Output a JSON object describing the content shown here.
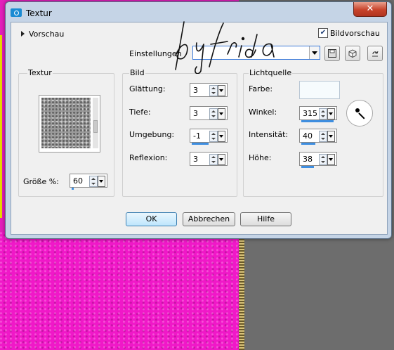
{
  "window": {
    "title": "Textur",
    "close_label": "✕"
  },
  "preview": {
    "toggle_label": "Vorschau",
    "checkbox_label": "Bildvorschau",
    "checked": true
  },
  "settings": {
    "label": "Einstellungen",
    "value": ""
  },
  "watermark": {
    "text": "by frida"
  },
  "texture_group": {
    "title": "Textur",
    "size_label": "Größe %:",
    "size_value": "60"
  },
  "image_group": {
    "title": "Bild",
    "fields": [
      {
        "label": "Glättung:",
        "value": "3"
      },
      {
        "label": "Tiefe:",
        "value": "3"
      },
      {
        "label": "Umgebung:",
        "value": "-1"
      },
      {
        "label": "Reflexion:",
        "value": "3"
      }
    ]
  },
  "light_group": {
    "title": "Lichtquelle",
    "color_label": "Farbe:",
    "color_value": "#f6fbfd",
    "fields": [
      {
        "label": "Winkel:",
        "value": "315"
      },
      {
        "label": "Intensität:",
        "value": "40"
      },
      {
        "label": "Höhe:",
        "value": "38"
      }
    ]
  },
  "buttons": {
    "ok": "OK",
    "cancel": "Abbrechen",
    "help": "Hilfe"
  },
  "colors": {
    "pink": "#f018c8",
    "accent": "#3e8ee0",
    "frame": "#c5d4e6"
  }
}
